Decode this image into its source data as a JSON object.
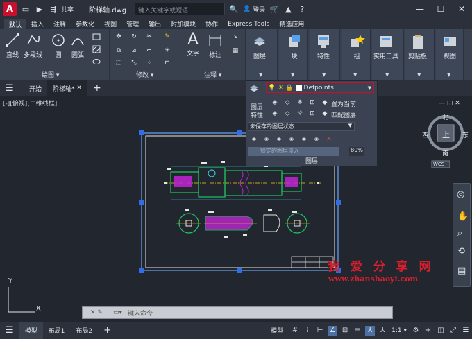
{
  "titlebar": {
    "app_letter": "A",
    "share_label": "共享",
    "filename": "阶梯轴.dwg",
    "search_placeholder": "键入关键字或短语",
    "login_label": "登录"
  },
  "ribbon_tabs": [
    "默认",
    "插入",
    "注释",
    "参数化",
    "视图",
    "管理",
    "输出",
    "附加模块",
    "协作",
    "Express Tools",
    "精选应用"
  ],
  "ribbon": {
    "draw": {
      "line": "直线",
      "polyline": "多段线",
      "circle": "圆",
      "arc": "圆弧",
      "group_label": "绘图"
    },
    "modify": {
      "group_label": "修改"
    },
    "annotation": {
      "text": "文字",
      "dimension": "标注",
      "group_label": "注释"
    },
    "layers": {
      "label": "图层"
    },
    "block": {
      "label": "块"
    },
    "properties": {
      "label": "特性"
    },
    "group": {
      "label": "组"
    },
    "utilities": {
      "label": "实用工具"
    },
    "clipboard": {
      "label": "剪贴板"
    },
    "view": {
      "label": "视图"
    }
  },
  "doc_tabs": {
    "start": "开始",
    "current": "阶梯轴*"
  },
  "viewport_label": "[-][俯视][二维线框]",
  "layer_flyout": {
    "current_layer": "Defpoints",
    "layer_text": "图层",
    "properties_text": "特性",
    "set_current": "置为当前",
    "match_layer": "匹配图层",
    "state": "未保存的图层状态",
    "fade_label": "锁定的图层淡入",
    "fade_value": "80%",
    "panel_title": "图层"
  },
  "viewcube": {
    "north": "北",
    "south": "南",
    "east": "东",
    "west": "西",
    "top": "上",
    "wcs": "WCS"
  },
  "watermark": {
    "cn": "我 爱 分 享 网",
    "url": "www.zhanshaoyi.com"
  },
  "command": {
    "placeholder": "键入命令"
  },
  "ucs": {
    "x": "X",
    "y": "Y"
  },
  "statusbar": {
    "model_tab": "模型",
    "layout1": "布局1",
    "layout2": "布局2",
    "model_button": "模型",
    "scale": "1:1"
  },
  "colors": {
    "accent": "#c8102e",
    "bg": "#21262f",
    "ribbon": "#39414f",
    "cad_green": "#22c55e",
    "cad_cyan": "#38d9f0",
    "cad_magenta": "#c026d3",
    "cad_yellow": "#facc15"
  }
}
